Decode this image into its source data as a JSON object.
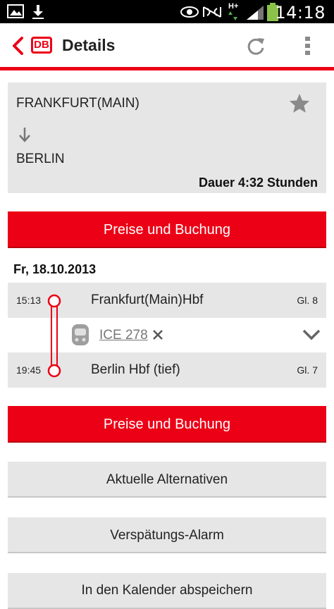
{
  "status_bar": {
    "time": "14:18",
    "network": "H+"
  },
  "app_bar": {
    "logo": "DB",
    "title": "Details"
  },
  "route": {
    "from": "FRANKFURT(MAIN)",
    "to": "BERLIN",
    "duration": "Dauer 4:32 Stunden"
  },
  "booking_label": "Preise und Buchung",
  "journey": {
    "date": "Fr, 18.10.2013",
    "departure": {
      "time": "15:13",
      "station": "Frankfurt(Main)Hbf",
      "platform": "Gl. 8"
    },
    "train": {
      "name": "ICE 278"
    },
    "arrival": {
      "time": "19:45",
      "station": "Berlin Hbf (tief)",
      "platform": "Gl. 7"
    }
  },
  "actions": {
    "alternatives": "Aktuelle Alternativen",
    "delay_alarm": "Verspätungs-Alarm",
    "calendar": "In den Kalender abspeichern"
  },
  "colors": {
    "accent": "#ec0016",
    "panel": "#e6e6e6",
    "status_bar": "#000000"
  }
}
